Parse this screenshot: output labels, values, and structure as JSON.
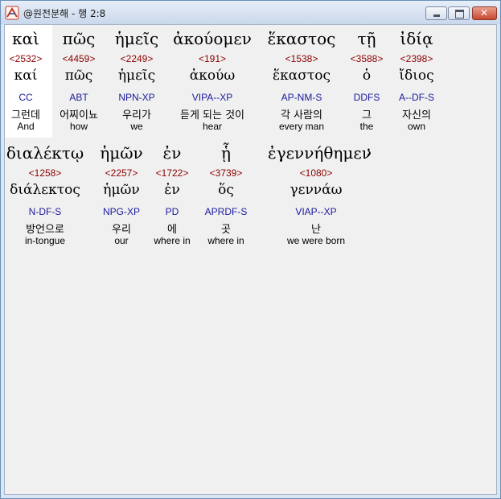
{
  "window": {
    "title": "@원전분해 - 행 2:8"
  },
  "rows": [
    {
      "words": [
        {
          "surface": "καὶ",
          "strongs": "<2532>",
          "lemma": "καί",
          "parse": "CC",
          "korean": "그런데",
          "english": "And"
        },
        {
          "surface": "πῶς",
          "strongs": "<4459>",
          "lemma": "πῶς",
          "parse": "ABT",
          "korean": "어찌이뇨",
          "english": "how"
        },
        {
          "surface": "ἡμεῖς",
          "strongs": "<2249>",
          "lemma": "ἡμεῖς",
          "parse": "NPN-XP",
          "korean": "우리가",
          "english": "we"
        },
        {
          "surface": "ἀκούομεν",
          "strongs": "<191>",
          "lemma": "ἀκούω",
          "parse": "VIPA--XP",
          "korean": "듣게 되는 것이",
          "english": "hear"
        },
        {
          "surface": "ἕκαστος",
          "strongs": "<1538>",
          "lemma": "ἕκαστος",
          "parse": "AP-NM-S",
          "korean": "각 사람의",
          "english": "every man"
        },
        {
          "surface": "τῇ",
          "strongs": "<3588>",
          "lemma": "ὁ",
          "parse": "DDFS",
          "korean": "그",
          "english": "the"
        },
        {
          "surface": "ἰδίᾳ",
          "strongs": "<2398>",
          "lemma": "ἴδιος",
          "parse": "A--DF-S",
          "korean": "자신의",
          "english": "own"
        }
      ]
    },
    {
      "words": [
        {
          "surface": "διαλέκτῳ",
          "strongs": "<1258>",
          "lemma": "διάλεκτος",
          "parse": "N-DF-S",
          "korean": "방언으로",
          "english": "in-tongue"
        },
        {
          "surface": "ἡμῶν",
          "strongs": "<2257>",
          "lemma": "ἡμῶν",
          "parse": "NPG-XP",
          "korean": "우리",
          "english": "our"
        },
        {
          "surface": "ἐν",
          "strongs": "<1722>",
          "lemma": "ἐν",
          "parse": "PD",
          "korean": "에",
          "english": "where in"
        },
        {
          "surface": "ᾗ",
          "strongs": "<3739>",
          "lemma": "ὅς",
          "parse": "APRDF-S",
          "korean": "곳",
          "english": "where in"
        },
        {
          "surface": "ἐγεννήθημεν",
          "strongs": "<1080>",
          "lemma": "γεννάω",
          "parse": "VIAP--XP",
          "korean": "난",
          "english": "we were born"
        }
      ]
    }
  ],
  "punctuation": ";",
  "colors": {
    "strongs": "#8b0000",
    "parse": "#1a1a9c",
    "highlight": "#ffffff"
  }
}
